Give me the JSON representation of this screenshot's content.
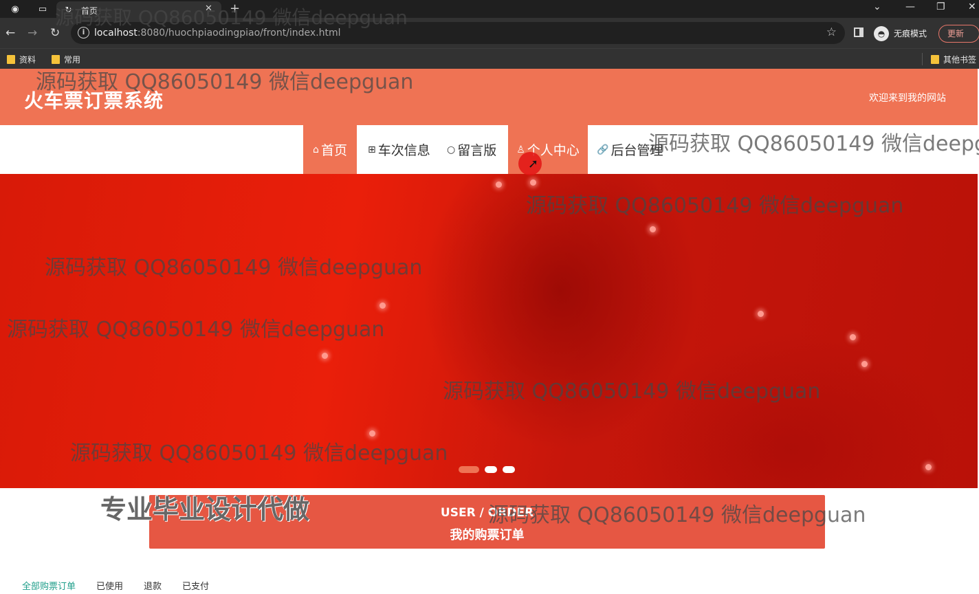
{
  "browser": {
    "tab_title": "首页",
    "new_tab_symbol": "+",
    "url_host": "localhost",
    "url_rest": ":8080/huochpiaodingpiao/front/index.html",
    "incognito_label": "无痕模式",
    "update_label": "更新",
    "bookmarks": [
      "资料",
      "常用"
    ],
    "other_bookmarks": "其他书签"
  },
  "site": {
    "title": "火车票订票系统",
    "welcome": "欢迎来到我的网站"
  },
  "nav": {
    "items": [
      {
        "label": "首页",
        "icon": "home-icon",
        "glyph": "⌂"
      },
      {
        "label": "车次信息",
        "icon": "grid-icon",
        "glyph": "⊞"
      },
      {
        "label": "留言版",
        "icon": "circle-icon",
        "glyph": "○"
      },
      {
        "label": "个人中心",
        "icon": "user-icon",
        "glyph": "♙"
      },
      {
        "label": "后台管理",
        "icon": "link-icon",
        "glyph": "🔗"
      }
    ],
    "active_index": 0
  },
  "banner": {
    "slide_count": 3,
    "active_slide": 0
  },
  "orders": {
    "heading_en": "USER / ORDER",
    "heading_cn": "我的购票订单",
    "tabs": [
      "全部购票订单",
      "已使用",
      "退款",
      "已支付"
    ],
    "active_tab": 0
  },
  "watermark": {
    "text": "源码获取 QQ86050149 微信deepguan",
    "truncated_text": "源码获取 QQ86050149 微信deepg",
    "big_text": "专业毕业设计代做"
  },
  "colors": {
    "header": "#ef7354",
    "banner": "#e01b0a",
    "order_card": "#e65743",
    "active_tab": "#1e9e8a"
  }
}
